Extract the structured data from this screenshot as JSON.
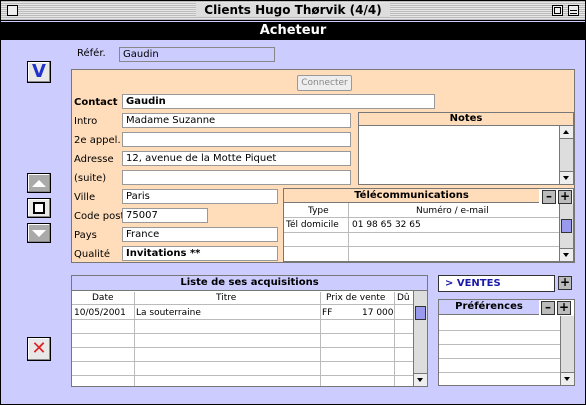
{
  "window": {
    "title": "Clients Hugo Thørvik (4/4)"
  },
  "header": {
    "title": "Acheteur"
  },
  "buttons": {
    "validate": "V",
    "delete": "✕",
    "connect": "Connecter"
  },
  "form": {
    "reference_label": "Référ.",
    "reference_value": "Gaudin",
    "contact_label": "Contact",
    "contact_value": "Gaudin",
    "intro_label": "Intro",
    "intro_value": "Madame Suzanne",
    "appel2_label": "2e appel.",
    "appel2_value": "",
    "adresse_label": "Adresse",
    "adresse_value": "12, avenue de la Motte Piquet",
    "suite_label": "(suite)",
    "suite_value": "",
    "ville_label": "Ville",
    "ville_value": "Paris",
    "cp_label": "Code post.",
    "cp_value": "75007",
    "pays_label": "Pays",
    "pays_value": "France",
    "qualite_label": "Qualité",
    "qualite_value": "Invitations **"
  },
  "notes": {
    "title": "Notes"
  },
  "telecom": {
    "title": "Télécommunications",
    "col_type": "Type",
    "col_numero": "Numéro / e-mail",
    "rows": [
      {
        "type": "Tél domicile",
        "numero": "01 98 65 32 65"
      }
    ]
  },
  "acquisitions": {
    "title": "Liste de ses acquisitions",
    "col_date": "Date",
    "col_titre": "Titre",
    "col_prix": "Prix de vente",
    "col_du": "Dû",
    "rows": [
      {
        "date": "10/05/2001",
        "titre": "La souterraine",
        "devise": "FF",
        "prix": "17 000"
      }
    ]
  },
  "ventes": {
    "label": "> VENTES",
    "plus": "+"
  },
  "preferences": {
    "title": "Préférences",
    "minus": "–",
    "plus": "+"
  },
  "colors": {
    "window_bg": "#ccccff",
    "panel_bg": "#ffddbb",
    "header_bg": "#000000",
    "accent_blue": "#2233cc",
    "delete_red": "#dd2222"
  },
  "icons": [
    "close-box-icon",
    "zoom-box-icon",
    "collapse-box-icon",
    "arrow-up-icon",
    "stop-square-icon",
    "arrow-down-icon",
    "check-v-icon",
    "delete-x-icon"
  ]
}
